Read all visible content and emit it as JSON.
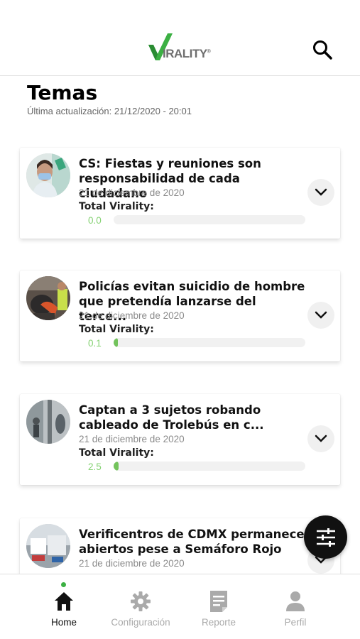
{
  "header": {
    "logo_text": "IRALITY",
    "logo_mark": "®",
    "search_icon": "search-icon"
  },
  "page": {
    "title": "Temas",
    "last_update": "Última actualización: 21/12/2020 - 20:01"
  },
  "colors": {
    "accent": "#3cb043",
    "score_text": "#86d274",
    "bar_fill": "#73c35c",
    "fab": "#111111"
  },
  "topics": [
    {
      "title": "CS: Fiestas y reuniones son responsabilidad de cada ciudadano",
      "date": "21 de diciembre de 2020",
      "virality_label": "Total Virality:",
      "score": "0.0",
      "score_fraction": 0.0
    },
    {
      "title": "Policías evitan suicidio de hombre que pretendía lanzarse del terce...",
      "date": "21 de diciembre de 2020",
      "virality_label": "Total Virality:",
      "score": "0.1",
      "score_fraction": 0.001
    },
    {
      "title": "Captan a 3 sujetos robando cableado de Trolebús en c...",
      "date": "21 de diciembre de 2020",
      "virality_label": "Total Virality:",
      "score": "2.5",
      "score_fraction": 0.025
    },
    {
      "title": "Verificentros de CDMX permanecen abiertos pese a Semáforo Rojo",
      "date": "21 de diciembre de 2020"
    }
  ],
  "nav": {
    "items": [
      {
        "label": "Home",
        "icon": "home-icon",
        "active": true
      },
      {
        "label": "Configuración",
        "icon": "gear-icon",
        "active": false
      },
      {
        "label": "Reporte",
        "icon": "report-icon",
        "active": false
      },
      {
        "label": "Perfil",
        "icon": "person-icon",
        "active": false
      }
    ]
  }
}
